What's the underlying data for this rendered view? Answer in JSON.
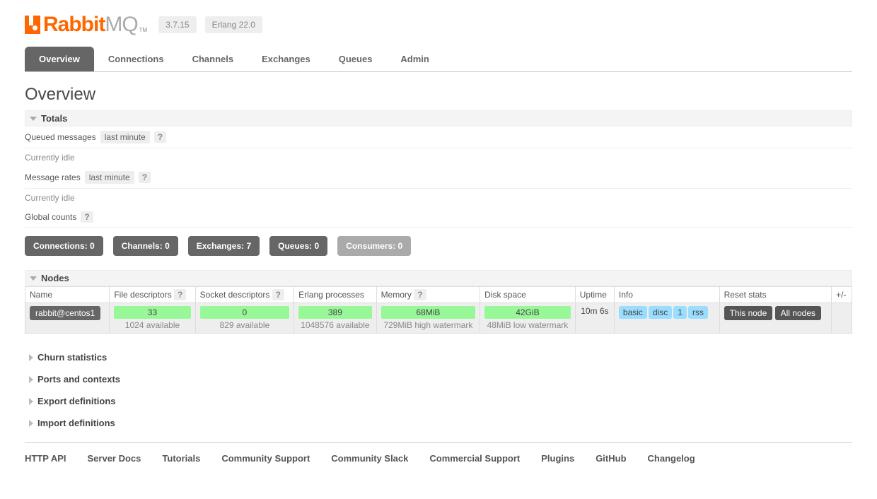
{
  "header": {
    "brand_a": "Rabbit",
    "brand_b": "MQ",
    "tm": "TM",
    "version": "3.7.15",
    "erlang": "Erlang 22.0"
  },
  "tabs": [
    "Overview",
    "Connections",
    "Channels",
    "Exchanges",
    "Queues",
    "Admin"
  ],
  "page_title": "Overview",
  "totals": {
    "heading": "Totals",
    "queued_label": "Queued messages",
    "last_minute": "last minute",
    "idle1": "Currently idle",
    "rates_label": "Message rates",
    "idle2": "Currently idle",
    "global_label": "Global counts",
    "help": "?"
  },
  "counts": [
    {
      "label": "Connections:",
      "value": "0",
      "dis": false
    },
    {
      "label": "Channels:",
      "value": "0",
      "dis": false
    },
    {
      "label": "Exchanges:",
      "value": "7",
      "dis": false
    },
    {
      "label": "Queues:",
      "value": "0",
      "dis": false
    },
    {
      "label": "Consumers:",
      "value": "0",
      "dis": true
    }
  ],
  "nodes": {
    "heading": "Nodes",
    "cols": [
      "Name",
      "File descriptors",
      "Socket descriptors",
      "Erlang processes",
      "Memory",
      "Disk space",
      "Uptime",
      "Info",
      "Reset stats",
      "+/-"
    ],
    "row": {
      "name": "rabbit@centos1",
      "fd": "33",
      "fd_sub": "1024 available",
      "sd": "0",
      "sd_sub": "829 available",
      "ep": "389",
      "ep_sub": "1048576 available",
      "mem": "68MiB",
      "mem_sub": "729MiB high watermark",
      "disk": "42GiB",
      "disk_sub": "48MiB low watermark",
      "uptime": "10m 6s",
      "info": [
        "basic",
        "disc",
        "1",
        "rss"
      ],
      "reset1": "This node",
      "reset2": "All nodes"
    }
  },
  "sections": [
    "Churn statistics",
    "Ports and contexts",
    "Export definitions",
    "Import definitions"
  ],
  "footer": [
    "HTTP API",
    "Server Docs",
    "Tutorials",
    "Community Support",
    "Community Slack",
    "Commercial Support",
    "Plugins",
    "GitHub",
    "Changelog"
  ]
}
